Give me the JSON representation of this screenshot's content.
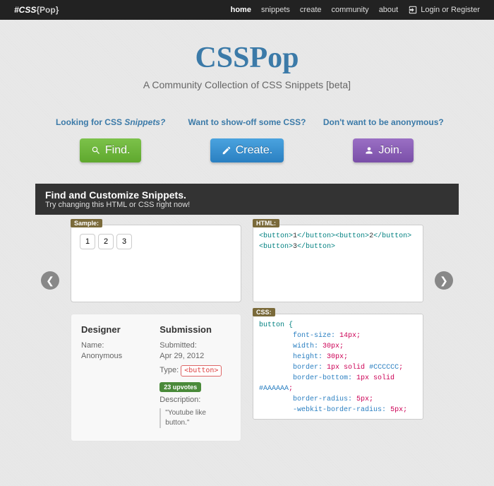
{
  "topbar": {
    "logo_prefix": "#CSS",
    "logo_suffix": "{Pop}",
    "nav": [
      "home",
      "snippets",
      "create",
      "community",
      "about"
    ],
    "login": "Login or Register"
  },
  "hero": {
    "brand": "CSSPop",
    "tagline": "A Community Collection of CSS Snippets [beta]"
  },
  "ctas": {
    "find_q": "Looking for CSS ",
    "find_q_em": "Snippets?",
    "find_btn": "Find.",
    "create_q": "Want to show-off some CSS?",
    "create_btn": "Create.",
    "join_q": "Don't want to be anonymous?",
    "join_btn": "Join."
  },
  "section": {
    "title": "Find and Customize Snippets.",
    "subtitle": "Try changing this HTML or CSS right now!"
  },
  "tags": {
    "sample": "Sample:",
    "html": "HTML:",
    "css": "CSS:"
  },
  "sample": {
    "b1": "1",
    "b2": "2",
    "b3": "3"
  },
  "html_code": "<button>1</button><button>2</button><button>3</button>",
  "css_code": {
    "l1": "button {",
    "l2a": "font-size:",
    "l2b": "14px;",
    "l3a": "width:",
    "l3b": "30px;",
    "l4a": "height:",
    "l4b": "30px;",
    "l5a": "border:",
    "l5b": "1px solid #CCCCCC;",
    "l6a": "border-bottom:",
    "l6b": "1px solid #AAAAAA;",
    "l7a": "border-radius:",
    "l7b": "5px;",
    "l8a": "-webkit-border-radius:",
    "l8b": "5px;"
  },
  "info": {
    "designer_h": "Designer",
    "designer_name": "Name: Anonymous",
    "submission_h": "Submission",
    "submitted_l": "Submitted:",
    "submitted_v": "Apr 29, 2012",
    "type_l": "Type:",
    "type_chip": "<button>",
    "upvotes": "23 upvotes",
    "desc_l": "Description:",
    "desc_v": "\"Youtube like button.\""
  }
}
